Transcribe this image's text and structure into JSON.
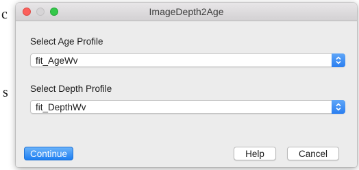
{
  "background": {
    "fragment_top": "c",
    "fragment_mid": "s"
  },
  "window": {
    "title": "ImageDepth2Age"
  },
  "age_profile": {
    "label": "Select Age Profile",
    "selected": "fit_AgeWv"
  },
  "depth_profile": {
    "label": "Select Depth Profile",
    "selected": "fit_DepthWv"
  },
  "buttons": {
    "continue": "Continue",
    "help": "Help",
    "cancel": "Cancel"
  },
  "icons": {
    "close": "close-icon",
    "minimize": "minimize-icon",
    "maximize": "maximize-icon",
    "stepper": "chevron-updown-icon"
  },
  "colors": {
    "accent": "#2a7ef0",
    "close": "#fc605c",
    "maximize": "#34c84a",
    "window_bg": "#ececec"
  }
}
